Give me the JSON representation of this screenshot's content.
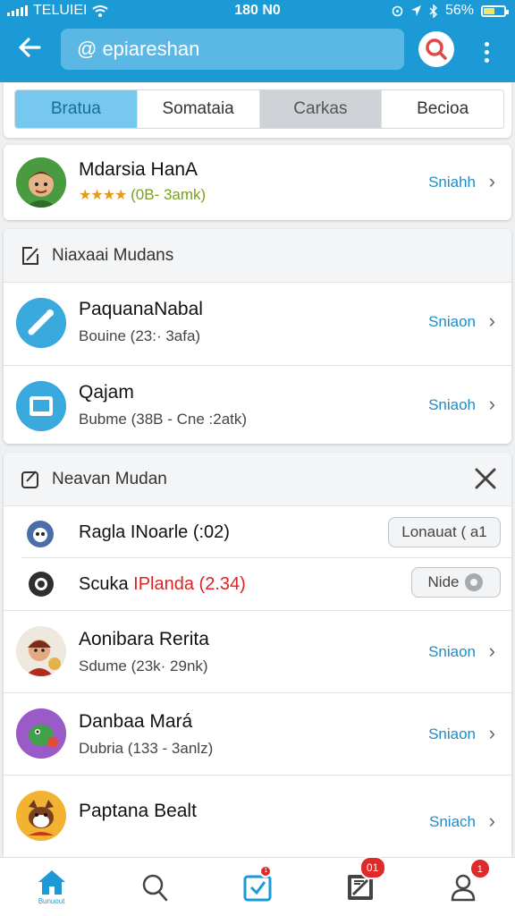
{
  "status_bar": {
    "carrier": "TELUIEI",
    "time": "180 N0",
    "battery": "56%",
    "battery_level": 0.56
  },
  "header": {
    "search_value": "@ epiareshan"
  },
  "segments": [
    "Bratua",
    "Somataia",
    "Carkas",
    "Becioa"
  ],
  "top_contact": {
    "name": "Mdarsia HanA",
    "stars": "★★★★",
    "rating_text": "(0B- 3amk)",
    "action": "Sniahh"
  },
  "section1": {
    "title": "Niaxaai Mudans",
    "items": [
      {
        "name": "PaquanaNabal",
        "sub": "Bouine (23:· 3afa)",
        "action": "Sniaon"
      },
      {
        "name": "Qajam",
        "sub": "Bubme (38B - Cne :2atk)",
        "action": "Sniaoh"
      }
    ]
  },
  "section2": {
    "title": "Neavan Mudan",
    "requests": [
      {
        "name": "Ragla INoarle (:02)",
        "button": "Lonauat ( a1"
      },
      {
        "name_a": "Scuka",
        "name_b": "IPlanda (2.34)",
        "button": "Nide"
      }
    ],
    "items": [
      {
        "name": "Aonibara Rerita",
        "sub": "Sdume (23k· 29nk)",
        "action": "Sniaon"
      },
      {
        "name": "Danbaa Mará",
        "sub": "Dubria (133 - 3anlz)",
        "action": "Sniaon"
      },
      {
        "name": "Paptana Bealt",
        "sub": "",
        "action": "Sniach"
      }
    ]
  },
  "bottom_nav": {
    "home_label": "Bunuout",
    "badge_inbox": "1",
    "badge_tasks": "01",
    "badge_profile": "1"
  },
  "colors": {
    "primary": "#1b9ad6",
    "accent_text": "#1e8dc6",
    "badge": "#e02a2a"
  }
}
